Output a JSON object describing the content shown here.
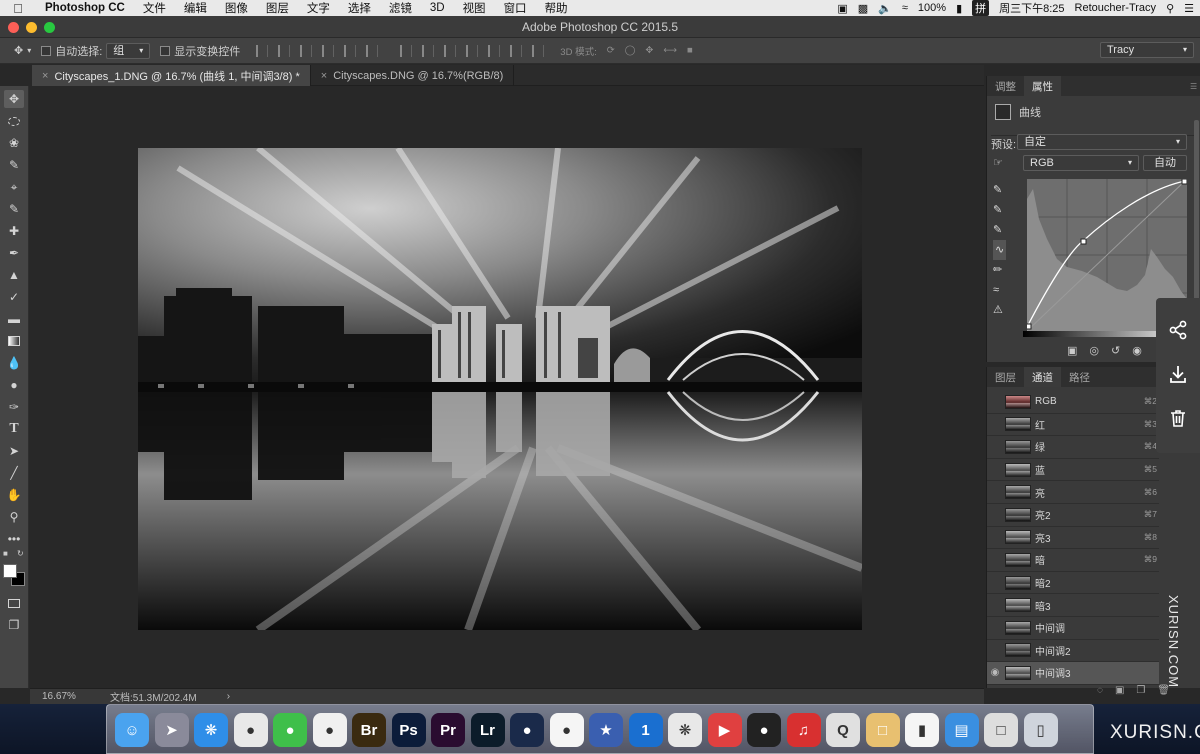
{
  "menubar": {
    "app_name": "Photoshop CC",
    "items": [
      "文件",
      "编辑",
      "图像",
      "图层",
      "文字",
      "选择",
      "滤镜",
      "3D",
      "视图",
      "窗口",
      "帮助"
    ],
    "battery": "100%",
    "input_method": "拼",
    "clock": "周三下午8:25",
    "user": "Retoucher-Tracy"
  },
  "window": {
    "title": "Adobe Photoshop CC 2015.5"
  },
  "options_bar": {
    "auto_select_label": "自动选择:",
    "auto_select_value": "组",
    "show_transform_label": "显示变换控件",
    "mode_3d_label": "3D 模式:",
    "workspace": "Tracy"
  },
  "tabs": [
    {
      "label": "Cityscapes_1.DNG @ 16.7% (曲线 1, 中间调3/8) *",
      "active": true
    },
    {
      "label": "Cityscapes.DNG @ 16.7%(RGB/8)",
      "active": false
    }
  ],
  "status": {
    "zoom": "16.67%",
    "doc": "文档:51.3M/202.4M",
    "arrow": "›"
  },
  "properties": {
    "tab_adjust": "调整",
    "tab_props": "属性",
    "panel_title": "曲线",
    "preset_label": "预设:",
    "preset_value": "自定",
    "channel_value": "RGB",
    "auto_button": "自动"
  },
  "channels_panel": {
    "tab_layers": "图层",
    "tab_channels": "通道",
    "tab_paths": "路径",
    "rows": [
      {
        "name": "RGB",
        "shortcut": "⌘2",
        "visible": false
      },
      {
        "name": "红",
        "shortcut": "⌘3",
        "visible": false
      },
      {
        "name": "绿",
        "shortcut": "⌘4",
        "visible": false
      },
      {
        "name": "蓝",
        "shortcut": "⌘5",
        "visible": false
      },
      {
        "name": "亮",
        "shortcut": "⌘6",
        "visible": false
      },
      {
        "name": "亮2",
        "shortcut": "⌘7",
        "visible": false
      },
      {
        "name": "亮3",
        "shortcut": "⌘8",
        "visible": false
      },
      {
        "name": "暗",
        "shortcut": "⌘9",
        "visible": false
      },
      {
        "name": "暗2",
        "shortcut": "",
        "visible": false
      },
      {
        "name": "暗3",
        "shortcut": "",
        "visible": false
      },
      {
        "name": "中间调",
        "shortcut": "",
        "visible": false
      },
      {
        "name": "中间调2",
        "shortcut": "",
        "visible": false
      },
      {
        "name": "中间调3",
        "shortcut": "",
        "visible": true
      }
    ]
  },
  "watermark": {
    "vertical": "XURISN.COM",
    "horizontal": "XURISN.COM"
  },
  "dock_apps": [
    "Finder",
    "Launchpad",
    "Safari",
    "Chrome",
    "WeChat",
    "QQ",
    "Br",
    "Ps",
    "Pr",
    "Lr",
    "Cinema 4D",
    "Baidu Netdisk",
    "iMovie",
    "1Password",
    "DaVinci",
    "Player",
    "OBS",
    "NetEase Music",
    "QuickTime",
    "Preview",
    "Numbers",
    "Keynote",
    "Screen",
    "Trash"
  ],
  "colors": {
    "accent": "#4a90e2",
    "panel_bg": "#3b3b3b",
    "canvas_bg": "#282828"
  }
}
